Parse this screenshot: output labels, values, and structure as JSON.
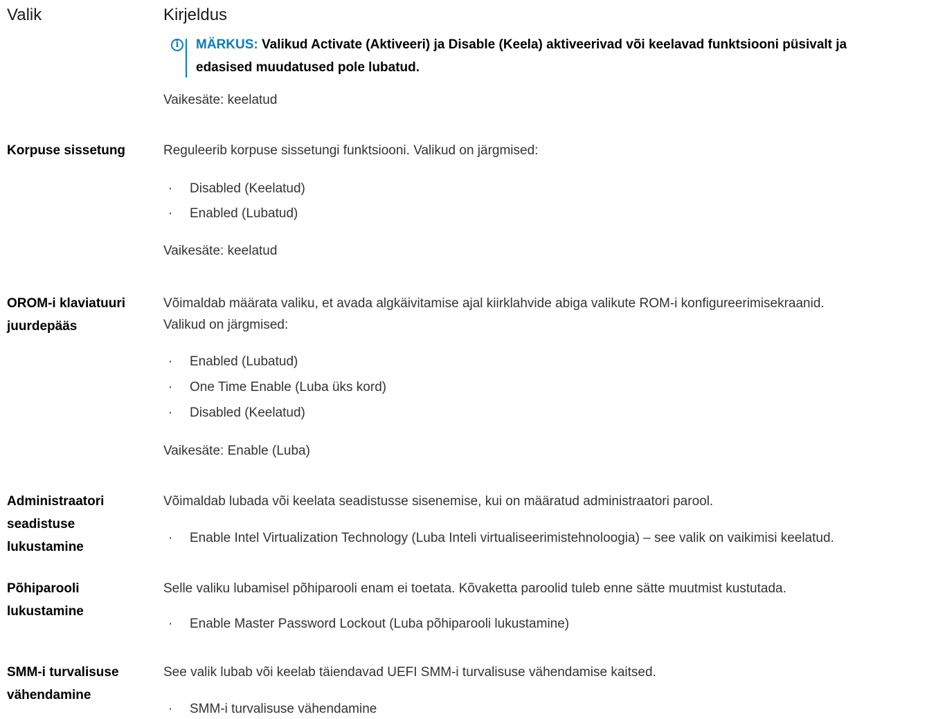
{
  "header": {
    "col_option": "Valik",
    "col_description": "Kirjeldus"
  },
  "note": {
    "label": "MÄRKUS:",
    "line1": "Valikud Activate (Aktiveeri) ja Disable (Keela) aktiveerivad või keelavad funktsiooni püsivalt ja",
    "line2": "edasised muudatused pole lubatud."
  },
  "default_top": "Vaikesäte: keelatud",
  "rows": [
    {
      "option_lines": [
        "Korpuse sissetung"
      ],
      "description_lines": [
        "Reguleerib korpuse sissetungi funktsiooni. Valikud on järgmised:"
      ],
      "bullets": [
        "Disabled (Keelatud)",
        "Enabled (Lubatud)"
      ],
      "default": "Vaikesäte: keelatud"
    },
    {
      "option_lines": [
        "OROM-i klaviatuuri",
        "juurdepääs"
      ],
      "description_lines": [
        "Võimaldab määrata valiku, et avada algkäivitamise ajal kiirklahvide abiga valikute ROM-i konfigureerimisekraanid.",
        "Valikud on järgmised:"
      ],
      "bullets": [
        "Enabled (Lubatud)",
        "One Time Enable (Luba üks kord)",
        "Disabled (Keelatud)"
      ],
      "default": "Vaikesäte: Enable (Luba)"
    },
    {
      "option_lines": [
        "Administraatori",
        "seadistuse",
        "lukustamine"
      ],
      "description_lines": [
        "Võimaldab lubada või keelata seadistusse sisenemise, kui on määratud administraatori parool."
      ],
      "bullets": [
        "Enable Intel Virtualization Technology (Luba Inteli virtualiseerimistehnoloogia) – see valik on vaikimisi keelatud."
      ]
    },
    {
      "option_lines": [
        "Põhiparooli",
        "lukustamine"
      ],
      "description_lines": [
        "Selle valiku lubamisel põhiparooli enam ei toetata. Kõvaketta paroolid tuleb enne sätte muutmist kustutada."
      ],
      "bullets": [
        "Enable Master Password Lockout (Luba põhiparooli lukustamine)"
      ]
    },
    {
      "option_lines": [
        "SMM-i turvalisuse",
        "vähendamine"
      ],
      "description_lines": [
        "See valik lubab või keelab täiendavad UEFI SMM-i turvalisuse vähendamise kaitsed."
      ],
      "bullets": [
        "SMM-i turvalisuse vähendamine"
      ]
    }
  ]
}
